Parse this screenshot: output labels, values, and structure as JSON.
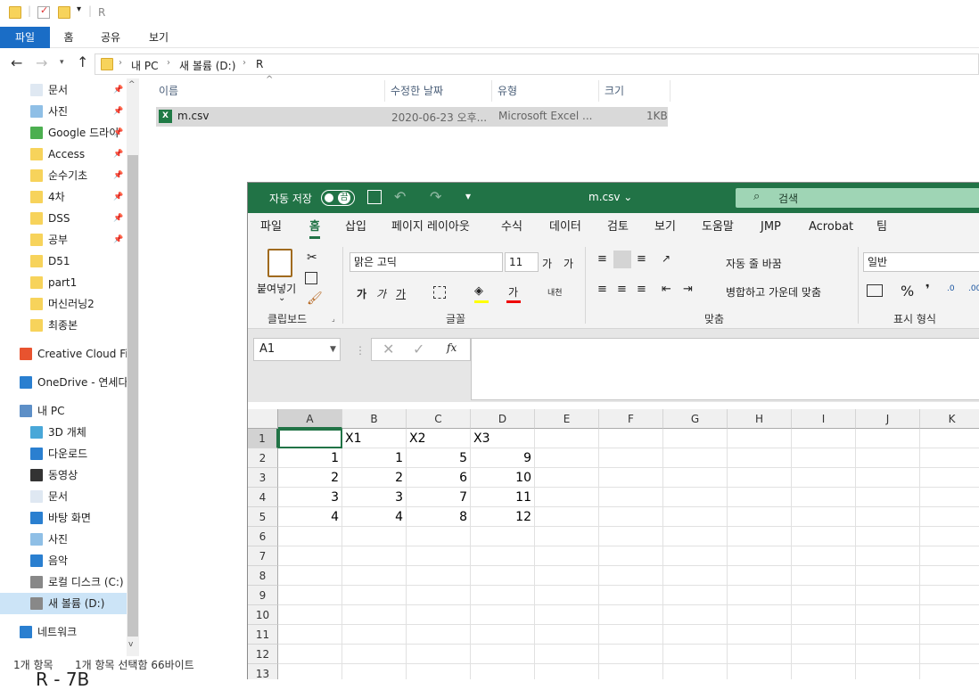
{
  "explorer": {
    "title": "R",
    "menu": [
      "파일",
      "홈",
      "공유",
      "보기"
    ],
    "breadcrumb": [
      "내 PC",
      "새 볼륨 (D:)",
      "R"
    ],
    "sidebar": [
      {
        "label": "문서",
        "icon": "document-icon",
        "pinned": true
      },
      {
        "label": "사진",
        "icon": "pictures-icon",
        "pinned": true
      },
      {
        "label": "Google 드라이",
        "icon": "google-drive-icon",
        "pinned": true
      },
      {
        "label": "Access",
        "icon": "folder-icon",
        "pinned": true
      },
      {
        "label": "순수기초",
        "icon": "folder-icon",
        "pinned": true
      },
      {
        "label": "4차",
        "icon": "folder-icon",
        "pinned": true
      },
      {
        "label": "DSS",
        "icon": "folder-icon",
        "pinned": true
      },
      {
        "label": "공부",
        "icon": "folder-icon",
        "pinned": true
      },
      {
        "label": "D51",
        "icon": "folder-icon",
        "pinned": false
      },
      {
        "label": "part1",
        "icon": "folder-icon",
        "pinned": false
      },
      {
        "label": "머신러닝2",
        "icon": "folder-icon",
        "pinned": false
      },
      {
        "label": "최종본",
        "icon": "folder-icon",
        "pinned": false
      },
      {
        "label": "Creative Cloud Fil",
        "icon": "creative-cloud-icon",
        "pinned": false
      },
      {
        "label": "OneDrive - 연세다",
        "icon": "onedrive-icon",
        "pinned": false
      },
      {
        "label": "내 PC",
        "icon": "pc-icon",
        "pinned": false
      },
      {
        "label": "3D 개체",
        "icon": "3d-objects-icon",
        "pinned": false
      },
      {
        "label": "다운로드",
        "icon": "downloads-icon",
        "pinned": false
      },
      {
        "label": "동영상",
        "icon": "videos-icon",
        "pinned": false
      },
      {
        "label": "문서",
        "icon": "document-icon",
        "pinned": false
      },
      {
        "label": "바탕 화면",
        "icon": "desktop-icon",
        "pinned": false
      },
      {
        "label": "사진",
        "icon": "pictures-icon",
        "pinned": false
      },
      {
        "label": "음악",
        "icon": "music-icon",
        "pinned": false
      },
      {
        "label": "로컬 디스크 (C:)",
        "icon": "drive-icon",
        "pinned": false
      },
      {
        "label": "새 볼륨 (D:)",
        "icon": "drive-icon",
        "pinned": false
      },
      {
        "label": "네트워크",
        "icon": "network-icon",
        "pinned": false
      }
    ],
    "columns": [
      "이름",
      "수정한 날짜",
      "유형",
      "크기"
    ],
    "file": {
      "name": "m.csv",
      "date": "2020-06-23 오후...",
      "type": "Microsoft Excel ...",
      "size": "1KB"
    },
    "status_count": "1개 항목",
    "status_selected": "1개 항목 선택함 66바이트"
  },
  "excel": {
    "autosave": "자동 저장",
    "autosave_state": "끔",
    "filename": "m.csv ⌄",
    "search": "검색",
    "tabs": [
      "파일",
      "홈",
      "삽입",
      "페이지 레이아웃",
      "수식",
      "데이터",
      "검토",
      "보기",
      "도움말",
      "JMP",
      "Acrobat",
      "팀"
    ],
    "clipboard": {
      "paste": "붙여넣기",
      "label": "클립보드"
    },
    "font": {
      "name": "맑은 고딕",
      "size": "11",
      "label": "글꼴",
      "bold": "가",
      "italic": "가",
      "underline": "가",
      "grow": "가",
      "shrink": "가",
      "color": "가",
      "phonetic": "내천"
    },
    "align": {
      "wrap": "자동 줄 바꿈",
      "merge": "병합하고 가운데 맞춤",
      "label": "맞춤"
    },
    "number": {
      "format": "일반",
      "label": "표시 형식",
      "percent": "%"
    },
    "namebox": "A1",
    "fx": "fx",
    "cols": [
      "A",
      "B",
      "C",
      "D",
      "E",
      "F",
      "G",
      "H",
      "I",
      "J",
      "K"
    ],
    "rows": [
      "1",
      "2",
      "3",
      "4",
      "5",
      "6",
      "7",
      "8",
      "9",
      "10",
      "11",
      "12",
      "13"
    ],
    "cells": [
      [
        "",
        "X1",
        "X2",
        "X3"
      ],
      [
        "1",
        "1",
        "5",
        "9"
      ],
      [
        "2",
        "2",
        "6",
        "10"
      ],
      [
        "3",
        "3",
        "7",
        "11"
      ],
      [
        "4",
        "4",
        "8",
        "12"
      ]
    ]
  },
  "background_text": "R - 7B"
}
